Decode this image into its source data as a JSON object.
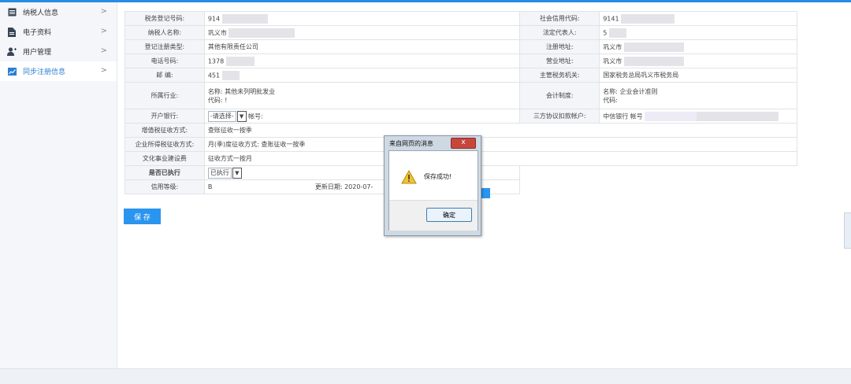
{
  "sidebar": {
    "items": [
      {
        "label": "纳税人信息",
        "icon": "document-list-icon"
      },
      {
        "label": "电子资料",
        "icon": "file-icon"
      },
      {
        "label": "用户管理",
        "icon": "user-icon"
      },
      {
        "label": "同步注册信息",
        "icon": "trend-chart-icon",
        "active": true
      }
    ]
  },
  "form": {
    "tax_reg_no": {
      "label": "税务登记号码:",
      "value": "914"
    },
    "credit_code": {
      "label": "社会信用代码:",
      "value": "9141"
    },
    "taxpayer_name": {
      "label": "纳税人名称:",
      "value": "巩义市"
    },
    "legal_rep": {
      "label": "法定代表人:",
      "value": "5"
    },
    "reg_type": {
      "label": "登记注册类型:",
      "value": "其他有限责任公司"
    },
    "reg_address": {
      "label": "注册地址:",
      "value": "巩义市"
    },
    "phone": {
      "label": "电话号码:",
      "value": "1378"
    },
    "biz_address": {
      "label": "营业地址:",
      "value": "巩义市"
    },
    "postcode": {
      "label": "邮 编:",
      "value": "451"
    },
    "tax_authority": {
      "label": "主管税务机关:",
      "value": "国家税务总局巩义市税务局"
    },
    "industry": {
      "label": "所属行业:",
      "name_line": "名称: 其他未列明批发业",
      "code_line": "代码: !"
    },
    "accounting": {
      "label": "会计制度:",
      "name_line": "名称: 企业会计准则",
      "code_line": "代码:"
    },
    "bank": {
      "label": "开户银行:",
      "select_value": "-请选择-",
      "account_label": "帐号:"
    },
    "tripartite": {
      "label": "三方协议扣款帐户:",
      "value": "中信银行 帐号"
    },
    "vat": {
      "label": "增值税征收方式:",
      "value": "查账征收一按季"
    },
    "cit": {
      "label": "企业所得税征收方式:",
      "value": "月(季)度征收方式: 查账征收一按季"
    },
    "culture_fee": {
      "label": "文化事业建设费",
      "value": "征收方式一按月"
    },
    "executed": {
      "label": "是否已执行",
      "select_value": "已执行"
    },
    "credit_level": {
      "label": "信用等级:",
      "value": "B",
      "update_label": "更新日期: 2020-07-"
    }
  },
  "save_button": "保 存",
  "dialog": {
    "title": "来自网页的消息",
    "close": "x",
    "message": "保存成功!",
    "ok": "确定"
  },
  "colors": {
    "accent": "#2a95ee",
    "sidebar_bg": "#f4f6f9",
    "close_red": "#c7463c"
  }
}
